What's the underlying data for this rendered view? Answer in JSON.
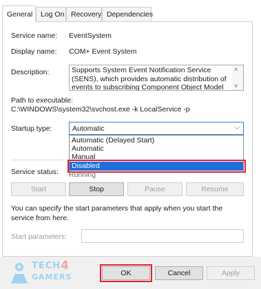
{
  "tabs": [
    "General",
    "Log On",
    "Recovery",
    "Dependencies"
  ],
  "service_name": {
    "label": "Service name:",
    "value": "EventSystem"
  },
  "display_name": {
    "label": "Display name:",
    "value": "COM+ Event System"
  },
  "description": {
    "label": "Description:",
    "text": "Supports System Event Notification Service (SENS), which provides automatic distribution of events to subscribing Component Object Model (COM)"
  },
  "path": {
    "label": "Path to executable:",
    "value": "C:\\WINDOWS\\system32\\svchost.exe -k LocalService -p"
  },
  "startup_type": {
    "label": "Startup type:",
    "selected": "Automatic",
    "options": [
      "Automatic (Delayed Start)",
      "Automatic",
      "Manual",
      "Disabled"
    ],
    "highlighted": "Disabled"
  },
  "service_status": {
    "label": "Service status:",
    "value": "Running"
  },
  "control_buttons": {
    "start": "Start",
    "stop": "Stop",
    "pause": "Pause",
    "resume": "Resume"
  },
  "params_hint": "You can specify the start parameters that apply when you start the service from here.",
  "start_params": {
    "label": "Start parameters:",
    "value": ""
  },
  "footer": {
    "ok": "OK",
    "cancel": "Cancel",
    "apply": "Apply"
  },
  "logo": {
    "line1": "TECH",
    "badge": "4",
    "line2": "GAMERS"
  },
  "colors": {
    "highlight": "#1e6fd9",
    "annotation_red": "#e02030",
    "combo_border": "#2f7fd4"
  }
}
